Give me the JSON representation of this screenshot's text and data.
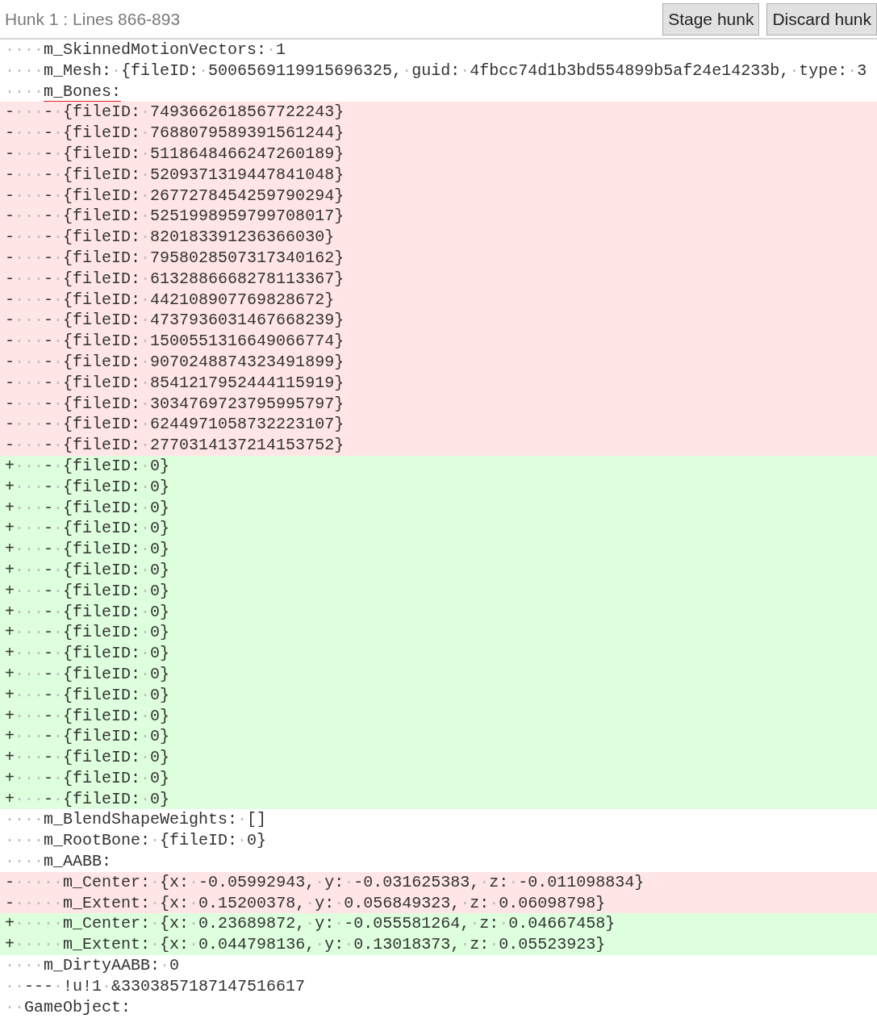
{
  "header": {
    "title": "Hunk 1 : Lines 866-893",
    "buttons": [
      "Stage hunk",
      "Discard hunk"
    ]
  },
  "lines": [
    {
      "kind": "context",
      "underlined": false,
      "text": "····m_SkinnedMotionVectors:·1"
    },
    {
      "kind": "context",
      "underlined": false,
      "text": "····m_Mesh:·{fileID:·5006569119915696325,·guid:·4fbcc74d1b3bd554899b5af24e14233b,·type:·3"
    },
    {
      "kind": "context",
      "underlined": true,
      "text": "····m_Bones:"
    },
    {
      "kind": "removed",
      "underlined": false,
      "text": "-···-·{fileID:·7493662618567722243}"
    },
    {
      "kind": "removed",
      "underlined": false,
      "text": "-···-·{fileID:·7688079589391561244}"
    },
    {
      "kind": "removed",
      "underlined": false,
      "text": "-···-·{fileID:·5118648466247260189}"
    },
    {
      "kind": "removed",
      "underlined": false,
      "text": "-···-·{fileID:·5209371319447841048}"
    },
    {
      "kind": "removed",
      "underlined": false,
      "text": "-···-·{fileID:·2677278454259790294}"
    },
    {
      "kind": "removed",
      "underlined": false,
      "text": "-···-·{fileID:·5251998959799708017}"
    },
    {
      "kind": "removed",
      "underlined": false,
      "text": "-···-·{fileID:·820183391236366030}"
    },
    {
      "kind": "removed",
      "underlined": false,
      "text": "-···-·{fileID:·7958028507317340162}"
    },
    {
      "kind": "removed",
      "underlined": false,
      "text": "-···-·{fileID:·6132886668278113367}"
    },
    {
      "kind": "removed",
      "underlined": false,
      "text": "-···-·{fileID:·442108907769828672}"
    },
    {
      "kind": "removed",
      "underlined": false,
      "text": "-···-·{fileID:·4737936031467668239}"
    },
    {
      "kind": "removed",
      "underlined": false,
      "text": "-···-·{fileID:·1500551316649066774}"
    },
    {
      "kind": "removed",
      "underlined": false,
      "text": "-···-·{fileID:·9070248874323491899}"
    },
    {
      "kind": "removed",
      "underlined": false,
      "text": "-···-·{fileID:·8541217952444115919}"
    },
    {
      "kind": "removed",
      "underlined": false,
      "text": "-···-·{fileID:·3034769723795995797}"
    },
    {
      "kind": "removed",
      "underlined": false,
      "text": "-···-·{fileID:·6244971058732223107}"
    },
    {
      "kind": "removed",
      "underlined": false,
      "text": "-···-·{fileID:·2770314137214153752}"
    },
    {
      "kind": "added",
      "underlined": false,
      "text": "+···-·{fileID:·0}"
    },
    {
      "kind": "added",
      "underlined": false,
      "text": "+···-·{fileID:·0}"
    },
    {
      "kind": "added",
      "underlined": false,
      "text": "+···-·{fileID:·0}"
    },
    {
      "kind": "added",
      "underlined": false,
      "text": "+···-·{fileID:·0}"
    },
    {
      "kind": "added",
      "underlined": false,
      "text": "+···-·{fileID:·0}"
    },
    {
      "kind": "added",
      "underlined": false,
      "text": "+···-·{fileID:·0}"
    },
    {
      "kind": "added",
      "underlined": false,
      "text": "+···-·{fileID:·0}"
    },
    {
      "kind": "added",
      "underlined": false,
      "text": "+···-·{fileID:·0}"
    },
    {
      "kind": "added",
      "underlined": false,
      "text": "+···-·{fileID:·0}"
    },
    {
      "kind": "added",
      "underlined": false,
      "text": "+···-·{fileID:·0}"
    },
    {
      "kind": "added",
      "underlined": false,
      "text": "+···-·{fileID:·0}"
    },
    {
      "kind": "added",
      "underlined": false,
      "text": "+···-·{fileID:·0}"
    },
    {
      "kind": "added",
      "underlined": false,
      "text": "+···-·{fileID:·0}"
    },
    {
      "kind": "added",
      "underlined": false,
      "text": "+···-·{fileID:·0}"
    },
    {
      "kind": "added",
      "underlined": false,
      "text": "+···-·{fileID:·0}"
    },
    {
      "kind": "added",
      "underlined": false,
      "text": "+···-·{fileID:·0}"
    },
    {
      "kind": "added",
      "underlined": false,
      "text": "+···-·{fileID:·0}"
    },
    {
      "kind": "context",
      "underlined": false,
      "text": "····m_BlendShapeWeights:·[]"
    },
    {
      "kind": "context",
      "underlined": false,
      "text": "····m_RootBone:·{fileID:·0}"
    },
    {
      "kind": "context",
      "underlined": false,
      "text": "····m_AABB:"
    },
    {
      "kind": "removed",
      "underlined": false,
      "text": "-·····m_Center:·{x:·-0.05992943,·y:·-0.031625383,·z:·-0.011098834}"
    },
    {
      "kind": "removed",
      "underlined": false,
      "text": "-·····m_Extent:·{x:·0.15200378,·y:·0.056849323,·z:·0.06098798}"
    },
    {
      "kind": "added",
      "underlined": false,
      "text": "+·····m_Center:·{x:·0.23689872,·y:·-0.055581264,·z:·0.04667458}"
    },
    {
      "kind": "added",
      "underlined": false,
      "text": "+·····m_Extent:·{x:·0.044798136,·y:·0.13018373,·z:·0.05523923}"
    },
    {
      "kind": "context",
      "underlined": false,
      "text": "····m_DirtyAABB:·0"
    },
    {
      "kind": "context",
      "underlined": false,
      "text": "··---·!u!1·&3303857187147516617"
    },
    {
      "kind": "context",
      "underlined": false,
      "text": "··GameObject:"
    }
  ]
}
